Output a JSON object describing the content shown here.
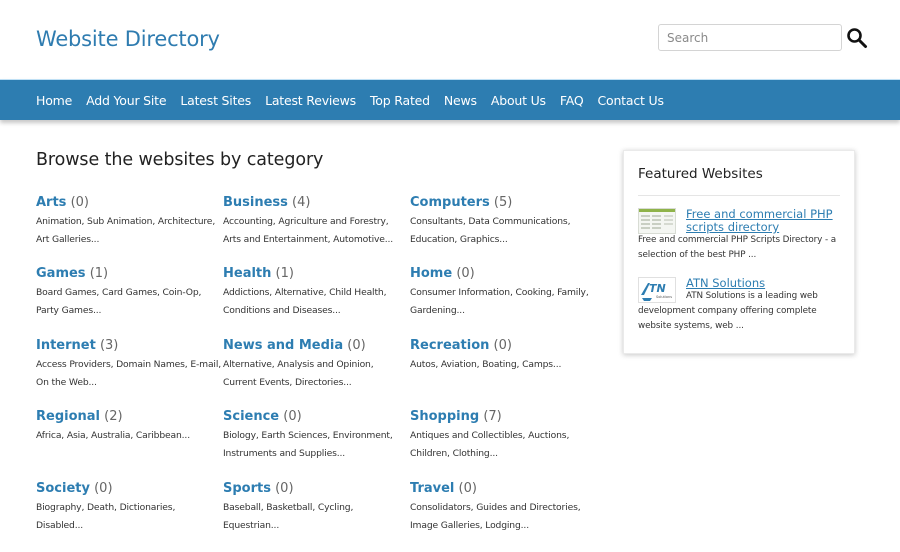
{
  "header": {
    "site_title": "Website Directory",
    "search_placeholder": "Search",
    "search_icon": "magnifier-icon"
  },
  "nav": {
    "items": [
      "Home",
      "Add Your Site",
      "Latest Sites",
      "Latest Reviews",
      "Top Rated",
      "News",
      "About Us",
      "FAQ",
      "Contact Us"
    ],
    "color": "#2d7db1"
  },
  "main": {
    "title": "Browse the websites by category",
    "categories": [
      {
        "name": "Arts",
        "count": "(0)",
        "subs": "Animation, Sub Animation, Architecture, Art Galleries..."
      },
      {
        "name": "Business",
        "count": "(4)",
        "subs": "Accounting, Agriculture and Forestry, Arts and Entertainment, Automotive..."
      },
      {
        "name": "Computers",
        "count": "(5)",
        "subs": "Consultants, Data Communications, Education, Graphics..."
      },
      {
        "name": "Games",
        "count": "(1)",
        "subs": "Board Games, Card Games, Coin-Op, Party Games..."
      },
      {
        "name": "Health",
        "count": "(1)",
        "subs": "Addictions, Alternative, Child Health, Conditions and Diseases..."
      },
      {
        "name": "Home",
        "count": "(0)",
        "subs": "Consumer Information, Cooking, Family, Gardening..."
      },
      {
        "name": "Internet",
        "count": "(3)",
        "subs": "Access Providers, Domain Names, E-mail, On the Web..."
      },
      {
        "name": "News and Media",
        "count": "(0)",
        "subs": "Alternative, Analysis and Opinion, Current Events, Directories..."
      },
      {
        "name": "Recreation",
        "count": "(0)",
        "subs": "Autos, Aviation, Boating, Camps..."
      },
      {
        "name": "Regional",
        "count": "(2)",
        "subs": "Africa, Asia, Australia, Caribbean..."
      },
      {
        "name": "Science",
        "count": "(0)",
        "subs": "Biology, Earth Sciences, Environment, Instruments and Supplies..."
      },
      {
        "name": "Shopping",
        "count": "(7)",
        "subs": "Antiques and Collectibles, Auctions, Children, Clothing..."
      },
      {
        "name": "Society",
        "count": "(0)",
        "subs": "Biography, Death, Dictionaries, Disabled..."
      },
      {
        "name": "Sports",
        "count": "(0)",
        "subs": "Baseball, Basketball, Cycling, Equestrian..."
      },
      {
        "name": "Travel",
        "count": "(0)",
        "subs": "Consolidators, Guides and Directories, Image Galleries, Lodging..."
      }
    ]
  },
  "featured": {
    "title": "Featured Websites",
    "items": [
      {
        "link": "Free and commercial PHP scripts directory ",
        "desc": "Free and commercial PHP Scripts Directory - a selection of the best PHP ...",
        "thumb": "php-scripts-screenshot-thumbnail"
      },
      {
        "link": "ATN Solutions ",
        "desc": "ATN Solutions is a leading web development company offering complete website systems, web ...",
        "thumb": "atn-logo",
        "logo_text": "ATN",
        "logo_sub": "Solutions"
      }
    ]
  }
}
